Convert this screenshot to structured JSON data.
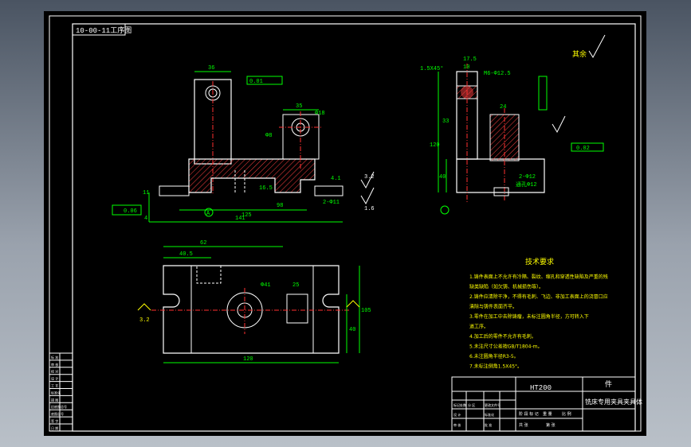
{
  "drawing_number": "10-00-11工序图",
  "roughness_rest": "其余",
  "material": "HT200",
  "part_title": "铣床专用夹具夹具体",
  "part_label": "件",
  "tech_requirements": {
    "title": "技术要求",
    "items": [
      "1.铸件表面上不允许有冷隔、裂纹、缩孔和穿透性缺陷及严重的残",
      "缺类缺陷（如欠铸、机械损伤等）。",
      "2.铸件应清除干净，不得有毛刺、飞边、非加工表面上的浇冒口应",
      "清除与铸件表面齐平。",
      "3.零件在加工中去除铸瘤，未标注圆角半径，方可转入下",
      "道工序。",
      "4.加工后的零件不允许有毛刺。",
      "5.未注尺寸公差按GB/T1804-m。",
      "6.未注圆角半径R3-5。",
      "7.未标注倒角1.5X45°。"
    ]
  },
  "front_view": {
    "dims": [
      "36",
      "35",
      "Φ12",
      "Φ18",
      "Φ8",
      "11",
      "4",
      "141",
      "98",
      "125",
      "Φ20",
      "2-Φ11",
      "18",
      "4.1",
      "16.5",
      "Φ15",
      "Φ40",
      "Φ6"
    ],
    "tolerances": [
      "0.01",
      "A",
      "0.06",
      "3.2",
      "1.6",
      "0.04",
      "+0.022",
      "0"
    ],
    "datum": "A"
  },
  "side_view": {
    "dims": [
      "17.5",
      "10",
      "1.5X45°",
      "M6-Φ12.5",
      "35",
      "33",
      "30",
      "120",
      "40",
      "34",
      "1.6",
      "2-Φ12",
      "通孔Φ12",
      "4.022",
      "24",
      "46"
    ],
    "tolerances": [
      "0.02",
      "0.012",
      "A"
    ]
  },
  "top_view": {
    "dims": [
      "62",
      "40.5",
      "Φ41",
      "25",
      "120",
      "40",
      "105"
    ],
    "roughness": "3.2"
  },
  "title_block": {
    "left_column": [
      "标 准",
      "审 核",
      "校 对",
      "设 计",
      "工 艺",
      "标准化",
      "描 图",
      "旧底图总号",
      "底图总号",
      "签 字",
      "日 期"
    ],
    "rows": [
      "标记处数",
      "分 区",
      "更改文件号",
      "签 名",
      "年 月 日",
      "设 计",
      "标准化",
      "审 核",
      "工 艺",
      "批 准"
    ],
    "cells": [
      "阶 段 标 记",
      "重 量",
      "比 例",
      "共 张",
      "第 张"
    ]
  },
  "colors": {
    "outline": "#ffffff",
    "dimension": "#00ff00",
    "center": "#ff3030",
    "hatch": "#ff4040",
    "cyan": "#00ffff",
    "yellow": "#ffff00"
  }
}
